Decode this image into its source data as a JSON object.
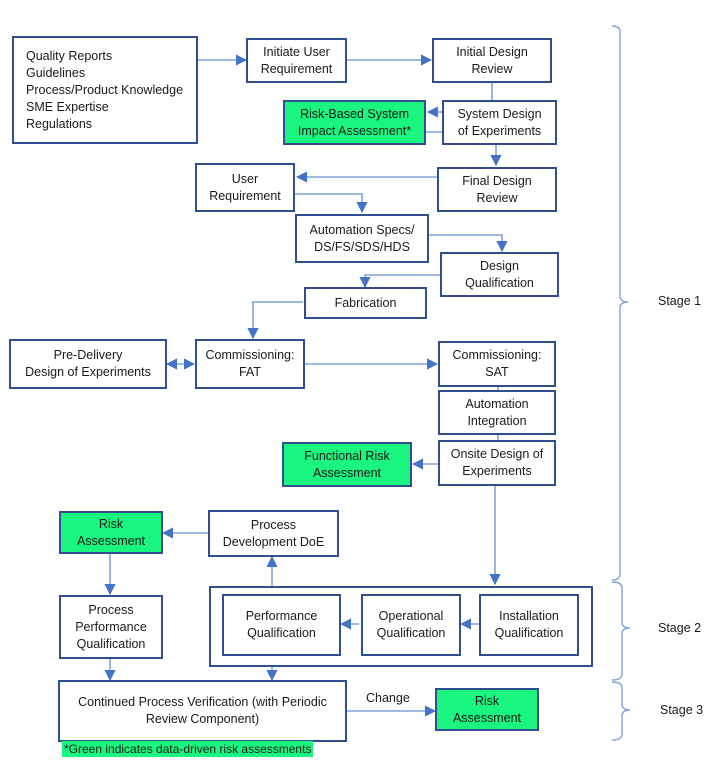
{
  "nodes": {
    "inputs": "Quality Reports\nGuidelines\nProcess/Product Knowledge\nSME Expertise\nRegulations",
    "initiate_user_requirement": "Initiate User\nRequirement",
    "initial_design_review": "Initial Design\nReview",
    "risk_based_system_impact": "Risk-Based System\nImpact Assessment*",
    "system_design_of_experiments": "System Design\nof Experiments",
    "final_design_review": "Final Design\nReview",
    "user_requirement": "User\nRequirement",
    "automation_specs": "Automation Specs/\nDS/FS/SDS/HDS",
    "design_qualification": "Design\nQualification",
    "fabrication": "Fabrication",
    "pre_delivery_doe": "Pre-Delivery\nDesign of Experiments",
    "commissioning_fat": "Commissioning:\nFAT",
    "commissioning_sat": "Commissioning:\nSAT",
    "automation_integration": "Automation\nIntegration",
    "onsite_doe": "Onsite Design of\nExperiments",
    "functional_risk_assessment": "Functional Risk\nAssessment",
    "risk_assessment_1": "Risk\nAssessment",
    "process_development_doe": "Process\nDevelopment DoE",
    "process_performance_qualification": "Process\nPerformance\nQualification",
    "performance_qualification": "Performance\nQualification",
    "operational_qualification": "Operational\nQualification",
    "installation_qualification": "Installation\nQualification",
    "continued_process_verification": "Continued Process Verification (with Periodic\nReview Component)",
    "risk_assessment_2": "Risk\nAssessment"
  },
  "edge_labels": {
    "change": "Change"
  },
  "stages": [
    "Stage 1",
    "Stage 2",
    "Stage 3"
  ],
  "footnote": "*Green indicates data-driven risk assessments",
  "colors": {
    "risk_green": "#19f57f",
    "box_border": "#2f4f8f",
    "connector": "#4472c4"
  }
}
